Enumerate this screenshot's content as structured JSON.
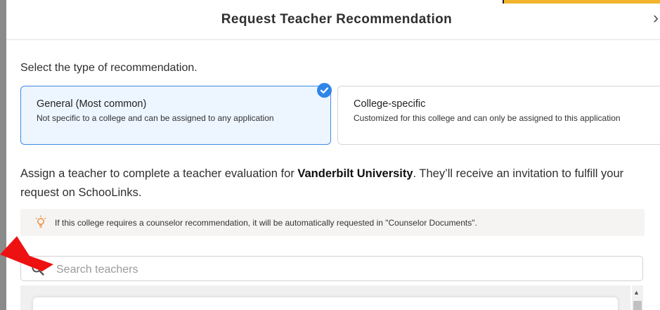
{
  "modal": {
    "title": "Request Teacher Recommendation",
    "close_glyph": "›"
  },
  "recommendation_type": {
    "prompt": "Select the type of recommendation.",
    "options": [
      {
        "title": "General (Most common)",
        "description": "Not specific to a college and can be assigned to any application",
        "selected": true
      },
      {
        "title": "College-specific",
        "description": "Customized for this college and can only be assigned to this application",
        "selected": false
      }
    ]
  },
  "assign": {
    "text_before": "Assign a teacher to complete a teacher evaluation for ",
    "college": "Vanderbilt University",
    "text_after": ". They’ll receive an invitation to fulfill your request on SchooLinks."
  },
  "notice": {
    "icon": "lightbulb-icon",
    "text": "If this college requires a counselor recommendation, it will be automatically requested in \"Counselor Documents\"."
  },
  "search": {
    "placeholder": "Search teachers",
    "value": ""
  },
  "colors": {
    "selected_border": "#3d8be6",
    "selected_bg": "#edf5ff",
    "check": "#2f86e8",
    "notice_icon": "#f0954a",
    "annotation_arrow": "#ee1111"
  }
}
